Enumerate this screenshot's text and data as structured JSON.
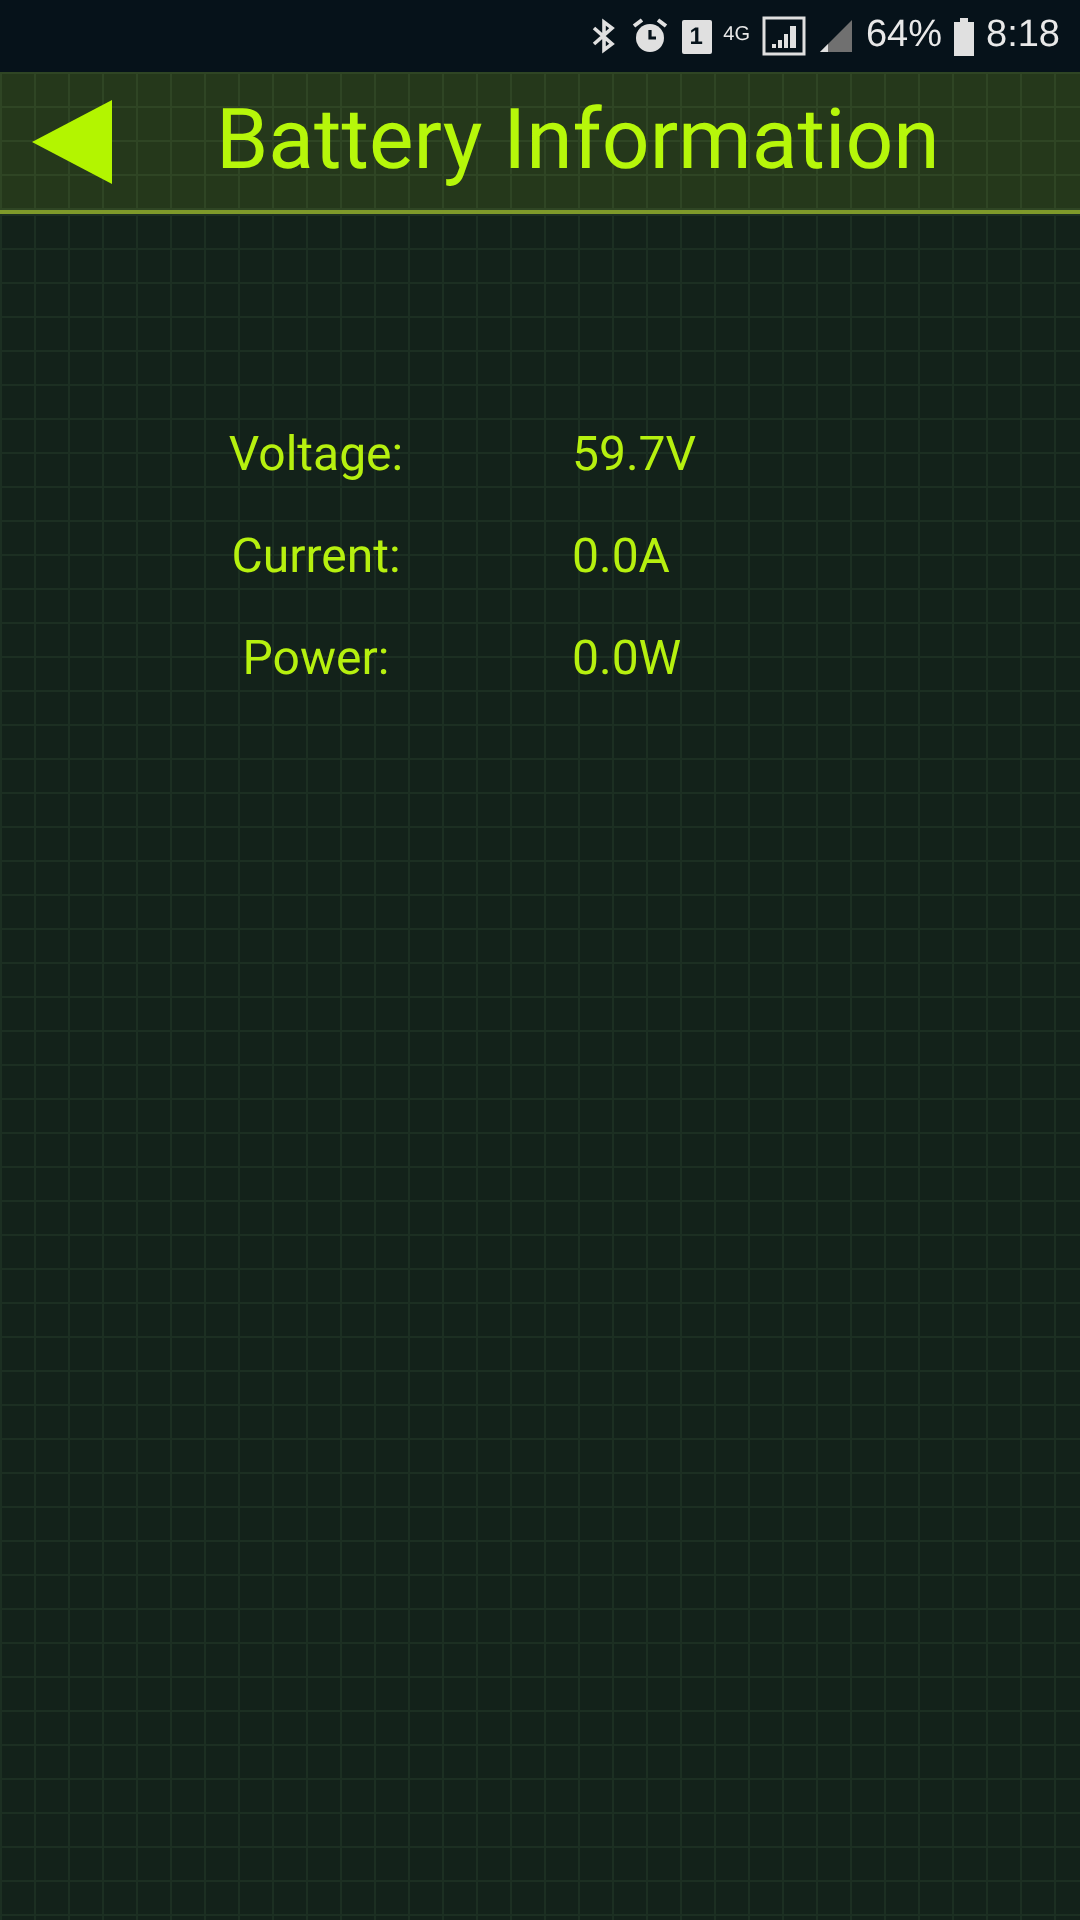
{
  "status_bar": {
    "sim_slot": "1",
    "network": "4G",
    "battery": "64%",
    "time": "8:18"
  },
  "header": {
    "title": "Battery Information"
  },
  "readings": [
    {
      "label": "Voltage:",
      "value": "59.7V"
    },
    {
      "label": "Current:",
      "value": "0.0A"
    },
    {
      "label": "Power:",
      "value": "0.0W"
    }
  ]
}
